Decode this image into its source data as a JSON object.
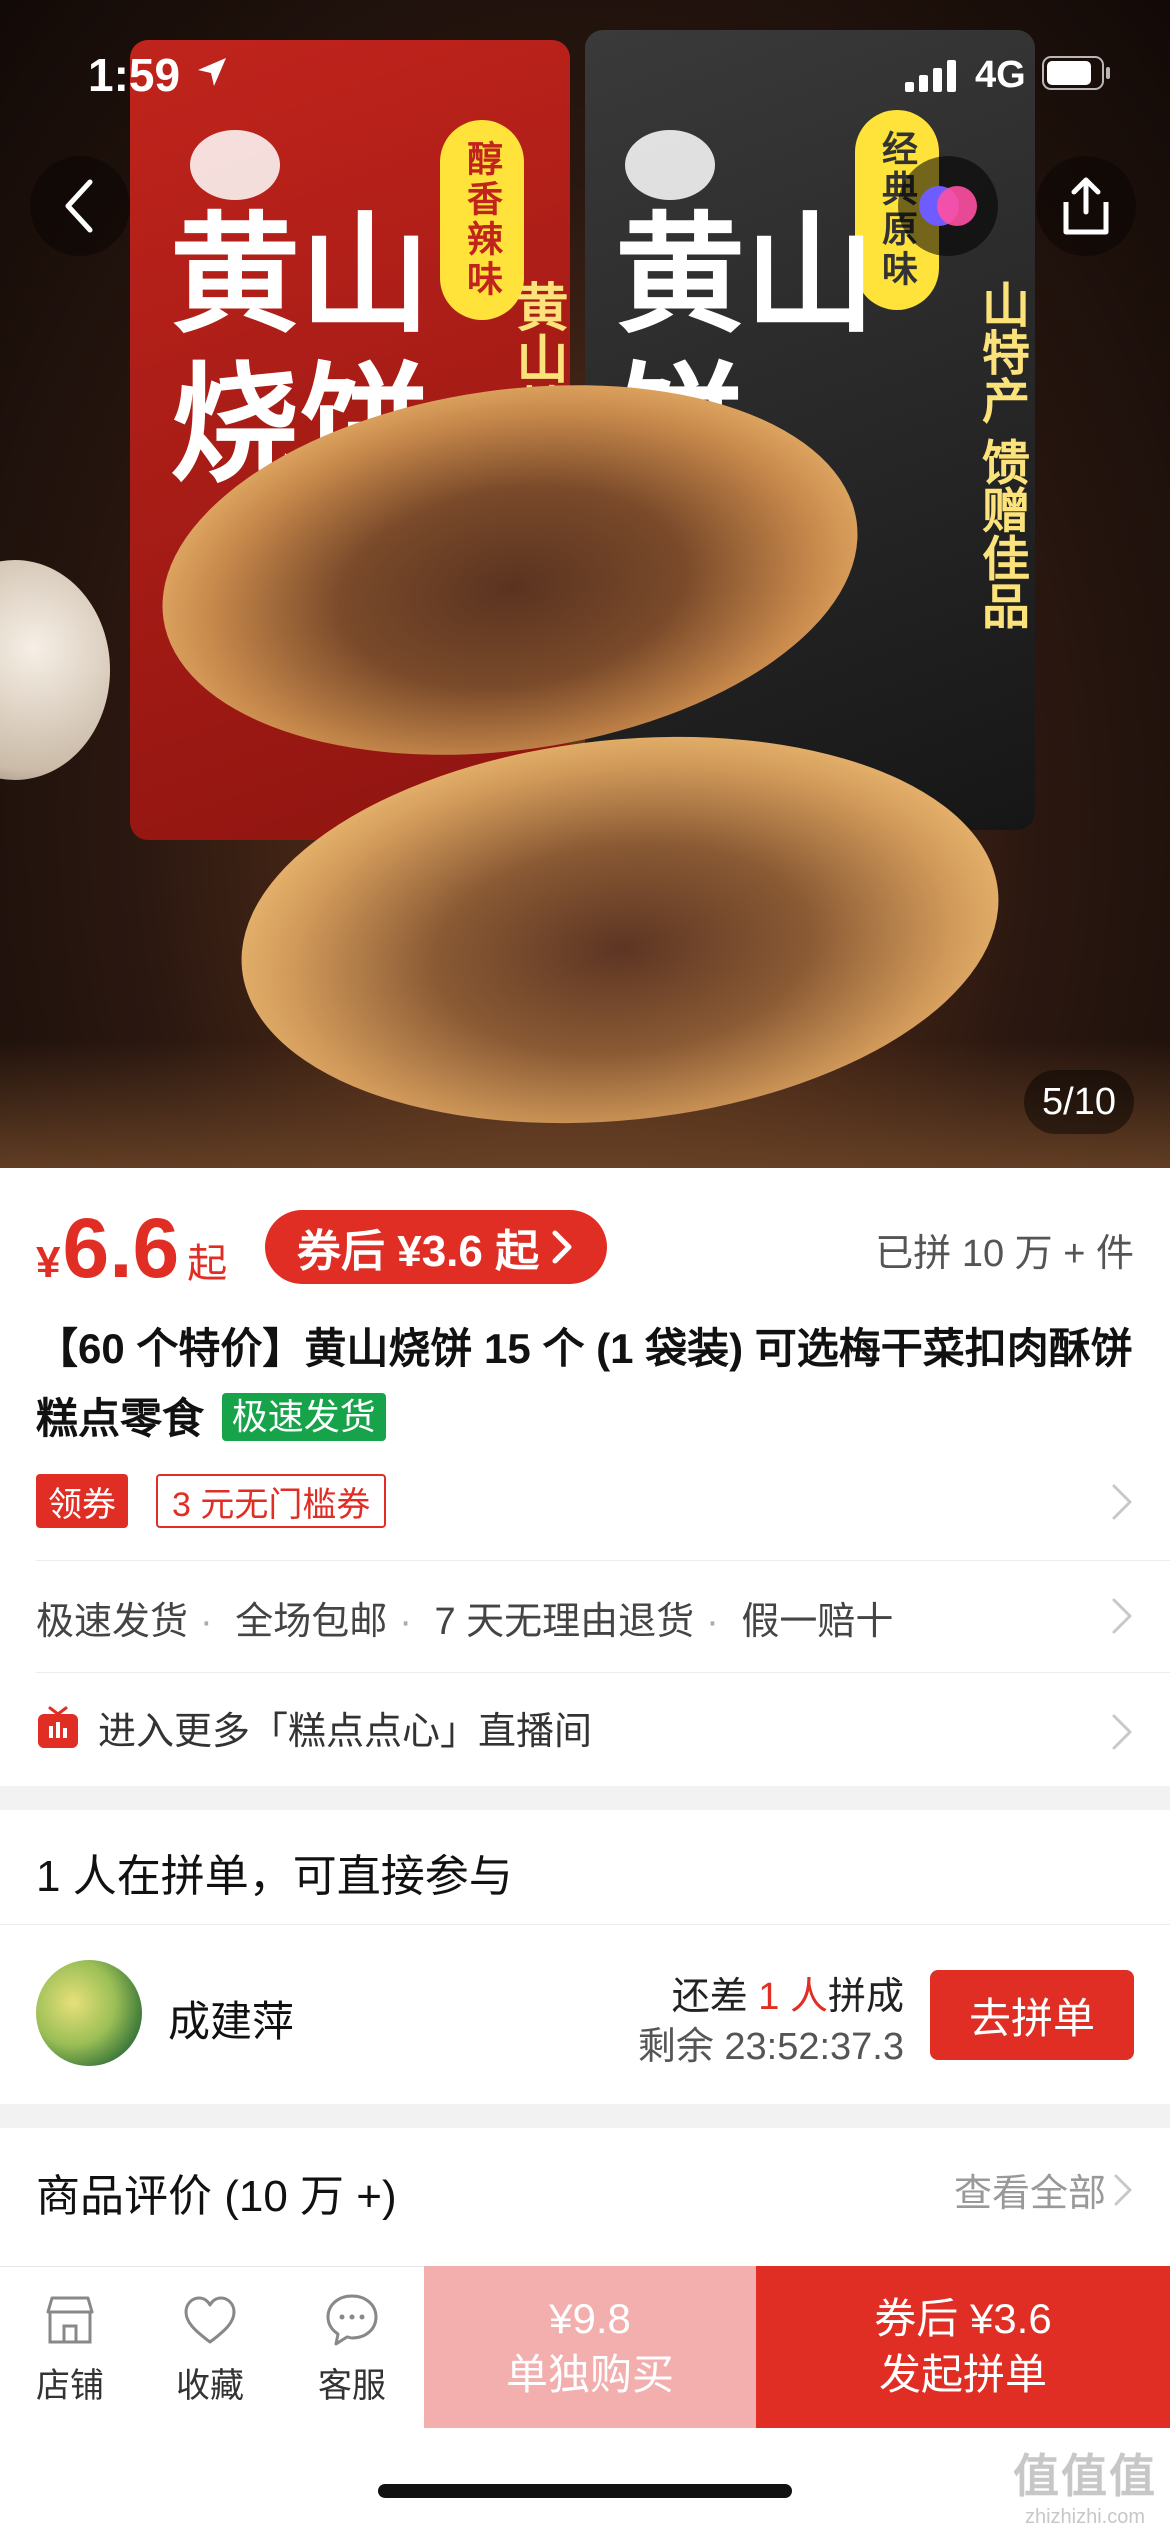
{
  "status_bar": {
    "time": "1:59",
    "network": "4G"
  },
  "hero": {
    "page_counter": "5/10",
    "bag_red": {
      "title": "黄山烧饼",
      "badge": "醇香辣味",
      "side": "黄山特"
    },
    "bag_black": {
      "title": "黄山饼",
      "badge": "经典原味",
      "side": "山特产 馈赠佳品"
    }
  },
  "price": {
    "currency": "¥",
    "value": "6.6",
    "suffix": "起",
    "coupon_text": "券后 ¥3.6 起",
    "sold": "已拼 10 万 + 件"
  },
  "product": {
    "title": "【60 个特价】黄山烧饼 15 个 (1 袋装) 可选梅干菜扣肉酥饼糕点零食",
    "fast_tag": "极速发货"
  },
  "coupon": {
    "label": "领券",
    "offer": "3 元无门槛券"
  },
  "services": [
    "极速发货",
    "全场包邮",
    "7 天无理由退货",
    "假一赔十"
  ],
  "live": {
    "text": "进入更多「糕点点心」直播间"
  },
  "group": {
    "heading": "1 人在拼单，可直接参与",
    "member_name": "成建萍",
    "need_prefix": "还差 ",
    "need_count": "1 人",
    "need_suffix": "拼成",
    "remaining": "剩余 23:52:37.3",
    "join_label": "去拼单"
  },
  "reviews": {
    "title": "商品评价 (10 万 +)",
    "view_all": "查看全部"
  },
  "bottom_bar": {
    "tabs": [
      {
        "label": "店铺",
        "icon": "store-icon"
      },
      {
        "label": "收藏",
        "icon": "heart-icon"
      },
      {
        "label": "客服",
        "icon": "chat-icon"
      }
    ],
    "buy_alone_price": "¥9.8",
    "buy_alone_label": "单独购买",
    "buy_group_price": "券后 ¥3.6",
    "buy_group_label": "发起拼单"
  },
  "watermark": {
    "big": "值值值",
    "small": "zhizhizhi.com"
  },
  "colors": {
    "accent": "#e02e24",
    "fast_tag": "#16a34a",
    "buy_alone_bg": "#f3aeae"
  }
}
